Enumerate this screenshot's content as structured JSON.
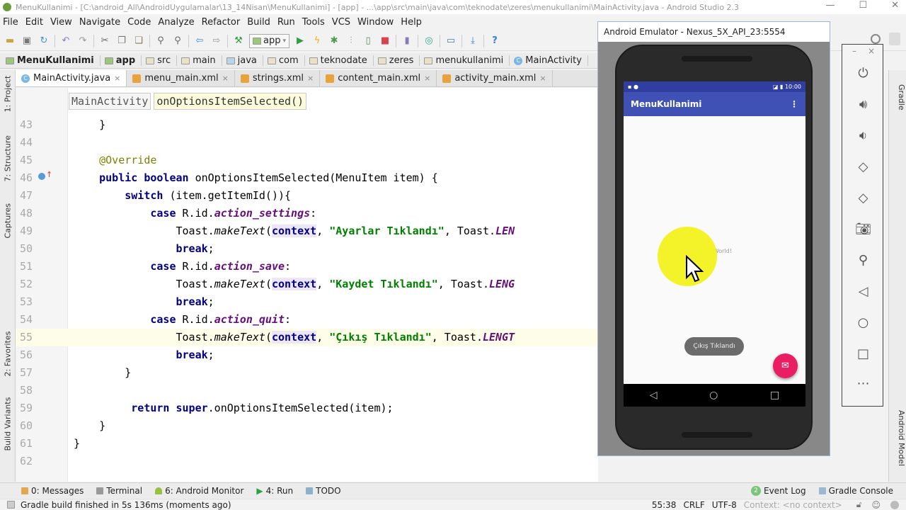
{
  "window": {
    "title": "MenuKullanimi - [C:\\android_All\\AndroidUygulamalar\\13_14Nisan\\MenuKullanimi] - [app] - ...\\app\\src\\main\\java\\com\\teknodate\\zeres\\menukullanimi\\MainActivity.java - Android Studio 2.3",
    "minimize": "—",
    "maximize": "☐",
    "close": "✕"
  },
  "menu": [
    "File",
    "Edit",
    "View",
    "Navigate",
    "Code",
    "Analyze",
    "Refactor",
    "Build",
    "Run",
    "Tools",
    "VCS",
    "Window",
    "Help"
  ],
  "toolbar": {
    "config": "app",
    "icons": [
      "open-folder",
      "save",
      "sync",
      "undo",
      "redo",
      "cut",
      "copy",
      "paste",
      "find",
      "replace",
      "back",
      "forward",
      "make",
      "run",
      "apply-changes",
      "debug",
      "attach-debugger",
      "profile",
      "stop",
      "avd-manager",
      "gradle-sync",
      "project-structure",
      "sdk-manager",
      "help"
    ]
  },
  "breadcrumb": [
    "MenuKullanimi",
    "app",
    "src",
    "main",
    "java",
    "com",
    "teknodate",
    "zeres",
    "menukullanimi",
    "MainActivity"
  ],
  "tabs": [
    {
      "label": "MainActivity.java",
      "active": true
    },
    {
      "label": "menu_main.xml",
      "active": false
    },
    {
      "label": "strings.xml",
      "active": false
    },
    {
      "label": "content_main.xml",
      "active": false
    },
    {
      "label": "activity_main.xml",
      "active": false
    }
  ],
  "left_tools": [
    "1: Project",
    "7: Structure",
    "Captures",
    "2: Favorites",
    "Build Variants"
  ],
  "right_tools": [
    "Gradle",
    "Android Model"
  ],
  "editor": {
    "nav_class": "MainActivity",
    "nav_method": "onOptionsItemSelected()",
    "current_line": 55,
    "lines": [
      {
        "n": "43",
        "code": "    }"
      },
      {
        "n": "44",
        "code": ""
      },
      {
        "n": "45",
        "code": "    @Override"
      },
      {
        "n": "46",
        "code": "    public boolean onOptionsItemSelected(MenuItem item) {"
      },
      {
        "n": "47",
        "code": "        switch (item.getItemId()){"
      },
      {
        "n": "48",
        "code": "            case R.id.action_settings:"
      },
      {
        "n": "49",
        "code": "                Toast.makeText(context, \"Ayarlar Tıklandı\", Toast.LEN"
      },
      {
        "n": "50",
        "code": "                break;"
      },
      {
        "n": "51",
        "code": "            case R.id.action_save:"
      },
      {
        "n": "52",
        "code": "                Toast.makeText(context, \"Kaydet Tıklandı\", Toast.LENG"
      },
      {
        "n": "53",
        "code": "                break;"
      },
      {
        "n": "54",
        "code": "            case R.id.action_quit:"
      },
      {
        "n": "55",
        "code": "                Toast.makeText(context, \"Çıkış Tıklandı\", Toast.LENGT"
      },
      {
        "n": "56",
        "code": "                break;"
      },
      {
        "n": "57",
        "code": "        }"
      },
      {
        "n": "58",
        "code": ""
      },
      {
        "n": "59",
        "code": "         return super.onOptionsItemSelected(item);"
      },
      {
        "n": "60",
        "code": "    }"
      },
      {
        "n": "61",
        "code": "}"
      },
      {
        "n": "62",
        "code": ""
      }
    ]
  },
  "bottom_tools": {
    "left": [
      "0: Messages",
      "Terminal",
      "6: Android Monitor",
      "4: Run",
      "TODO"
    ],
    "event_log": "Event Log",
    "event_log_count": "2",
    "gradle_console": "Gradle Console"
  },
  "status": {
    "message": "Gradle build finished in 5s 136ms (moments ago)",
    "position": "55:38",
    "line_sep": "CRLF",
    "encoding": "UTF-8",
    "context": "Context: <no context>"
  },
  "emulator": {
    "title": "Android Emulator - Nexus_5X_API_23:5554",
    "time": "10:00",
    "app_title": "MenuKullanimi",
    "hello": "Hello World!",
    "toast": "Çıkış Tıklandı",
    "panel_buttons": [
      "power",
      "volume-up",
      "volume-down",
      "rotate-left",
      "rotate-right",
      "screenshot",
      "zoom",
      "back",
      "home",
      "overview",
      "more"
    ]
  },
  "colors": {
    "app_bar": "#3f51b5",
    "status_bar": "#303f9f",
    "fab": "#e91e63",
    "cursor_highlight": "#f4f32a",
    "keyword": "#000080",
    "string": "#008000",
    "field": "#660e7a"
  }
}
